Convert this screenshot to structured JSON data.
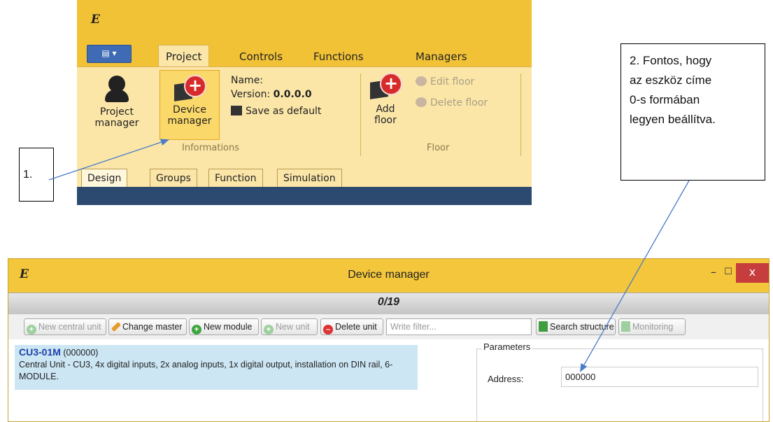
{
  "ribbon": {
    "app_logo": "E",
    "file_menu_label": "▤ ▾",
    "tabs": [
      {
        "label": "Project"
      },
      {
        "label": "Controls"
      },
      {
        "label": "Functions"
      },
      {
        "label": "Managers"
      }
    ],
    "buttons": {
      "project_manager": "Project manager",
      "device_manager": "Device manager",
      "add_floor": "Add floor",
      "edit_floor": "Edit floor",
      "delete_floor": "Delete floor",
      "save_as_default": "Save as default"
    },
    "info": {
      "name_label": "Name:",
      "version_label": "Version:",
      "version_value": "0.0.0.0"
    },
    "groups": {
      "informations": "Informations",
      "floor": "Floor"
    },
    "doc_tabs": [
      {
        "label": "Design"
      },
      {
        "label": "Groups"
      },
      {
        "label": "Function"
      },
      {
        "label": "Simulation"
      }
    ]
  },
  "callouts": {
    "one": "1.",
    "two_lines": [
      "2. Fontos, hogy",
      "az eszköz címe",
      "0-s formában",
      "legyen beállítva."
    ]
  },
  "device_manager": {
    "app_logo": "E",
    "title": "Device manager",
    "window_buttons": {
      "minimize": "–",
      "maximize": "☐",
      "close": "x"
    },
    "counter": "0/19",
    "toolbar": {
      "new_central_unit": "New central unit",
      "change_master": "Change master",
      "new_module": "New module",
      "new_unit": "New unit",
      "delete_unit": "Delete unit",
      "filter_placeholder": "Write filter...",
      "search_structure": "Search structure",
      "monitoring": "Monitoring"
    },
    "unit": {
      "name": "CU3-01M",
      "address": "(000000)",
      "description": "Central Unit - CU3, 4x digital inputs, 2x analog inputs, 1x digital output, installation on DIN rail, 6-MODULE."
    },
    "parameters": {
      "legend": "Parameters",
      "address_label": "Address:",
      "address_value": "000000"
    }
  },
  "colors": {
    "ribbon_yellow": "#f2c236",
    "panel_yellow": "#fbe6a8",
    "highlight": "#fbd86a",
    "arrow_blue": "#4a7cc7",
    "selection_blue": "#cce6f4",
    "close_red": "#c73c3c"
  }
}
